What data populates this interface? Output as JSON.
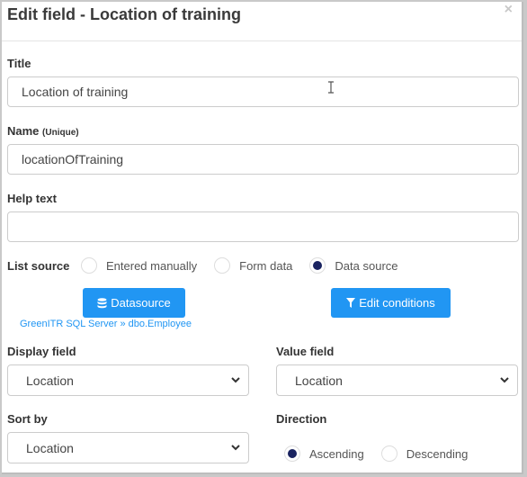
{
  "dialog": {
    "title": "Edit field - Location of training",
    "close_icon": "×"
  },
  "form": {
    "title_label": "Title",
    "title_value": "Location of training",
    "name_label": "Name",
    "name_hint": "(Unique)",
    "name_value": "locationOfTraining",
    "help_label": "Help text",
    "help_value": "",
    "list_source": {
      "label": "List source",
      "options": [
        {
          "label": "Entered manually",
          "checked": false
        },
        {
          "label": "Form data",
          "checked": false
        },
        {
          "label": "Data source",
          "checked": true
        }
      ]
    },
    "datasource_button": "Datasource",
    "edit_conditions_button": "Edit conditions",
    "datasource_link": "GreenITR SQL Server » dbo.Employee",
    "display_field_label": "Display field",
    "display_field_value": "Location",
    "value_field_label": "Value field",
    "value_field_value": "Location",
    "sort_by_label": "Sort by",
    "sort_by_value": "Location",
    "direction": {
      "label": "Direction",
      "options": [
        {
          "label": "Ascending",
          "checked": true
        },
        {
          "label": "Descending",
          "checked": false
        }
      ]
    }
  },
  "colors": {
    "accent": "#2196f3",
    "radio_checked": "#1a2360"
  }
}
